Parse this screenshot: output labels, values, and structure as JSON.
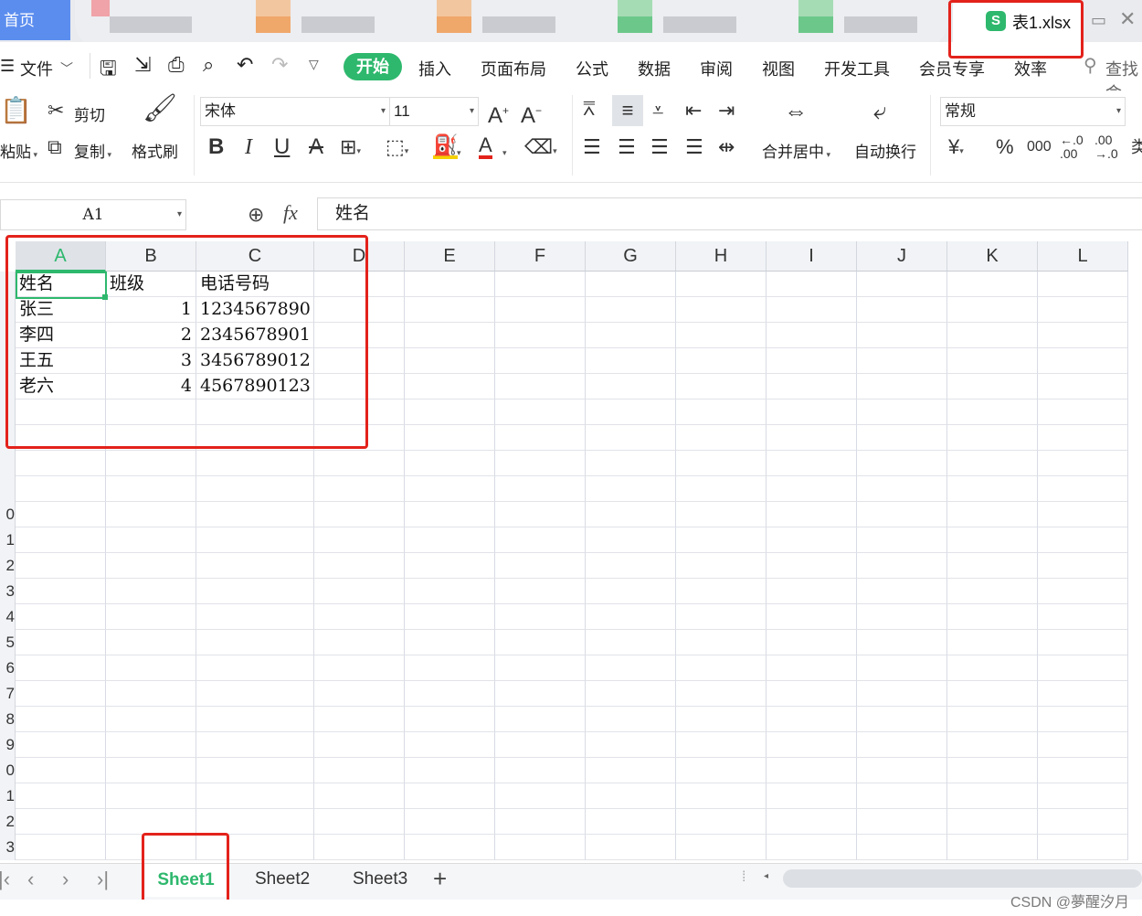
{
  "titlebar": {
    "home_tab": "首页",
    "file_name": "表1.xlsx",
    "app_logo": "S"
  },
  "menu": {
    "file_label": "文件",
    "tabs": [
      "开始",
      "插入",
      "页面布局",
      "公式",
      "数据",
      "审阅",
      "视图",
      "开发工具",
      "会员专享",
      "效率"
    ],
    "search_label": "查找命"
  },
  "ribbon": {
    "paste_label": "粘贴",
    "cut_label": "剪切",
    "copy_label": "复制",
    "format_painter_label": "格式刷",
    "font_name": "宋体",
    "font_size": "11",
    "merge_label": "合并居中",
    "wrap_label": "自动换行",
    "number_format": "常规"
  },
  "formula_bar": {
    "cell_ref": "A1",
    "fx_label": "fx",
    "content": "姓名"
  },
  "grid": {
    "columns": [
      "A",
      "B",
      "C",
      "D",
      "E",
      "F",
      "G",
      "H",
      "I",
      "J",
      "K",
      "L"
    ],
    "row_numbers": [
      "",
      "",
      "",
      "",
      "",
      "",
      "",
      "",
      "",
      "0",
      "1",
      "2",
      "3",
      "4",
      "5",
      "6",
      "7",
      "8",
      "9",
      "0",
      "1",
      "2",
      "3"
    ],
    "rows": [
      [
        "姓名",
        "班级",
        "电话号码"
      ],
      [
        "张三",
        "1",
        "1234567890"
      ],
      [
        "李四",
        "2",
        "2345678901"
      ],
      [
        "王五",
        "3",
        "3456789012"
      ],
      [
        "老六",
        "4",
        "4567890123"
      ]
    ],
    "active_cell": "A1"
  },
  "sheet_tabs": [
    "Sheet1",
    "Sheet2",
    "Sheet3"
  ],
  "active_sheet": "Sheet1",
  "watermark": "CSDN @夢醒汐月",
  "colors": {
    "accent": "#2eb86d",
    "highlight": "#e3221b",
    "home_tab": "#5b8def"
  }
}
